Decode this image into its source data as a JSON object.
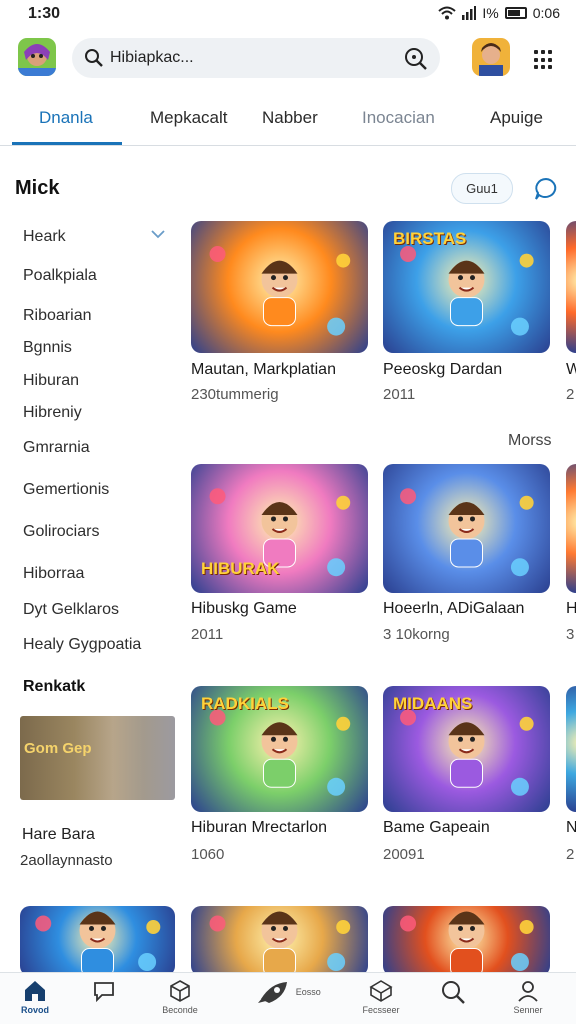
{
  "status_bar": {
    "time": "1:30",
    "battery_text": "0:06",
    "battery_level": 0.75,
    "signal_text": "I%"
  },
  "search": {
    "value": "Hibiapkac..."
  },
  "tabs": [
    {
      "label": "Dnanla",
      "active": true
    },
    {
      "label": "Mepkacalt",
      "active": false
    },
    {
      "label": "Nabber",
      "active": false
    },
    {
      "label": "Inocacian",
      "active": false
    },
    {
      "label": "Apuige",
      "active": false
    }
  ],
  "sidebar": {
    "title": "Mick",
    "items": [
      {
        "label": "Heark"
      },
      {
        "label": "Poalkpiala"
      },
      {
        "label": "Riboarian"
      },
      {
        "label": "Bgnnis"
      },
      {
        "label": "Hiburan"
      },
      {
        "label": "Hibreniy"
      },
      {
        "label": "Gmrarnia"
      },
      {
        "label": "Gemertionis"
      },
      {
        "label": "Golirociars"
      },
      {
        "label": "Hiborraa"
      },
      {
        "label": "Dyt Gelklaros"
      },
      {
        "label": "Healy Gygpoatia"
      }
    ],
    "section_title": "Renkatk",
    "promo": {
      "image_text": "Gom Gep",
      "title": "Hare Bara",
      "subtitle": "2aollaynnasto"
    }
  },
  "filter": {
    "label": "Guu1"
  },
  "more_label": "Morss",
  "games": [
    {
      "title": "Mautan, Markplatian",
      "subtitle": "230tummerig",
      "image_text": "",
      "accent": "#ff8a1e"
    },
    {
      "title": "Peeoskg Dardan",
      "subtitle": "2011",
      "image_text": "BIRSTAS",
      "accent": "#3da0e8"
    },
    {
      "title": "W",
      "subtitle": "2",
      "image_text": "",
      "accent": "#ff6a2a"
    },
    {
      "title": "Hibuskg Game",
      "subtitle": "2011",
      "image_text": "HIBURAK",
      "accent": "#f07bc0"
    },
    {
      "title": "Hoeerln, ADiGalaan",
      "subtitle": "3 10korng",
      "image_text": "",
      "accent": "#5a8ee8"
    },
    {
      "title": "H",
      "subtitle": "3",
      "image_text": "",
      "accent": "#ff7a32"
    },
    {
      "title": "Hiburan Mrectarlon",
      "subtitle": "1060",
      "image_text": "RADKIALS",
      "accent": "#7ccf6a"
    },
    {
      "title": "Bame Gapeain",
      "subtitle": "20091",
      "image_text": "MIDAANS",
      "accent": "#9b5ae0"
    },
    {
      "title": "N",
      "subtitle": "2",
      "image_text": "",
      "accent": "#3ea8e0"
    },
    {
      "title": "",
      "subtitle": "",
      "image_text": "",
      "accent": "#2f8ee0"
    },
    {
      "title": "",
      "subtitle": "",
      "image_text": "",
      "accent": "#e7a84a"
    },
    {
      "title": "",
      "subtitle": "",
      "image_text": "",
      "accent": "#e2501e"
    }
  ],
  "bottom_nav": [
    {
      "label": "Rovod",
      "icon": "home-icon",
      "active": true
    },
    {
      "label": "",
      "icon": "chat-bubble-icon",
      "active": false
    },
    {
      "label": "Beconde",
      "icon": "cube-icon",
      "active": false
    },
    {
      "label": "Eosso",
      "icon": "rocket-icon",
      "active": false
    },
    {
      "label": "Fecsseer",
      "icon": "box-icon",
      "active": false
    },
    {
      "label": "",
      "icon": "search-icon",
      "active": false
    },
    {
      "label": "Senner",
      "icon": "profile-icon",
      "active": false
    }
  ],
  "colors": {
    "accent": "#1a73b8",
    "divider": "#d8dde2",
    "search_bg": "#eef1f4"
  }
}
